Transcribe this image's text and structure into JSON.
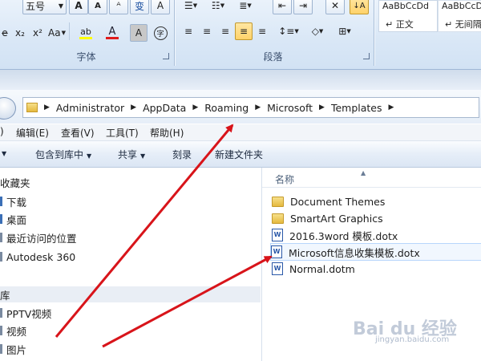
{
  "ribbon": {
    "font_size_value": "五号",
    "font_group_label": "字体",
    "paragraph_group_label": "段落",
    "style_sample_1": "AaBbCcDd",
    "style_sample_2": "AaBbCcD",
    "style_name_1": "↵ 正文",
    "style_name_2": "↵ 无间隔",
    "btn_grow": "A",
    "btn_shrink": "A",
    "btn_clear": "ᴬ",
    "btn_change_case": "变",
    "btn_subscript": "x₂",
    "btn_superscript": "x²",
    "btn_case": "Aa",
    "btn_highlight": "ab",
    "btn_font_color": "A",
    "btn_char_shading": "A",
    "btn_enclose": "字",
    "btn_sort": "↓A"
  },
  "address": {
    "crumbs": [
      "Administrator",
      "AppData",
      "Roaming",
      "Microsoft",
      "Templates"
    ]
  },
  "menu": {
    "items": [
      "编辑(E)",
      "查看(V)",
      "工具(T)",
      "帮助(H)"
    ]
  },
  "toolbar": {
    "include_library": "包含到库中",
    "share": "共享",
    "burn": "刻录",
    "new_folder": "新建文件夹"
  },
  "nav": {
    "favorites": "收藏夹",
    "favorites_items": [
      "下载",
      "桌面",
      "最近访问的位置",
      "Autodesk 360"
    ],
    "libraries": "库",
    "library_items": [
      "PPTV视频",
      "视频",
      "图片"
    ]
  },
  "files": {
    "column_name": "名称",
    "items": [
      {
        "name": "Document Themes",
        "type": "folder"
      },
      {
        "name": "SmartArt Graphics",
        "type": "folder"
      },
      {
        "name": "2016.3word 模板.dotx",
        "type": "word"
      },
      {
        "name": "Microsoft信息收集模板.dotx",
        "type": "word"
      },
      {
        "name": "Normal.dotm",
        "type": "word"
      }
    ]
  },
  "watermark": {
    "brand": "Bai du 经验",
    "sub": "jingyan.baidu.com"
  },
  "colors": {
    "arrow": "#d8141a",
    "accent": "#2a58a8"
  }
}
